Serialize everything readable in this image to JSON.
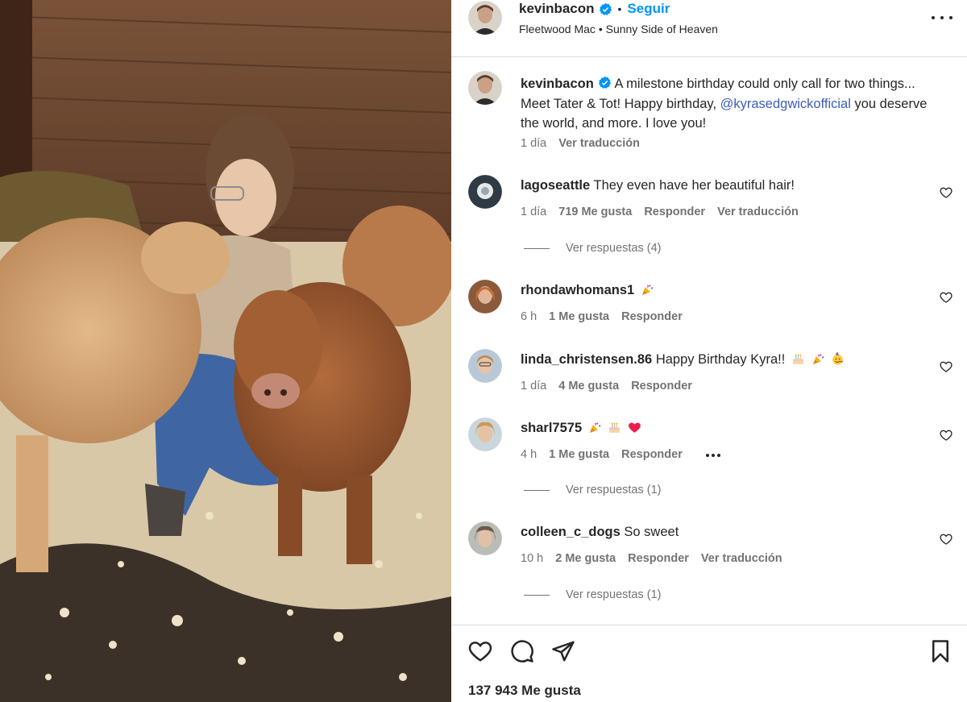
{
  "post": {
    "author": "kevinbacon",
    "follow_label": "Seguir",
    "audio": "Fleetwood Mac • Sunny Side of Heaven"
  },
  "caption": {
    "username": "kevinbacon",
    "text_before": "A milestone birthday could only call for two things... Meet Tater & Tot! Happy birthday, ",
    "mention": "@kyrasedgwickofficial",
    "text_after": " you deserve the world, and more. I love you!",
    "time": "1 día",
    "translate": "Ver traducción"
  },
  "comments": [
    {
      "username": "lagoseattle",
      "text": "They even have her beautiful hair!",
      "time": "1 día",
      "likes": "719 Me gusta",
      "reply": "Responder",
      "translate": "Ver traducción",
      "replies": "Ver respuestas (4)"
    },
    {
      "username": "rhondawhomans1",
      "text": "",
      "emojis": [
        "party-popper-emoji"
      ],
      "time": "6 h",
      "likes": "1 Me gusta",
      "reply": "Responder"
    },
    {
      "username": "linda_christensen.86",
      "text": "Happy Birthday Kyra!!",
      "emojis": [
        "birthday-cake-emoji",
        "party-popper-emoji",
        "partying-face-emoji"
      ],
      "time": "1 día",
      "likes": "4 Me gusta",
      "reply": "Responder"
    },
    {
      "username": "sharl7575",
      "text": "",
      "emojis": [
        "party-popper-emoji",
        "birthday-cake-emoji",
        "red-heart-emoji"
      ],
      "time": "4 h",
      "likes": "1 Me gusta",
      "reply": "Responder",
      "replies": "Ver respuestas (1)"
    },
    {
      "username": "colleen_c_dogs",
      "text": "So sweet",
      "time": "10 h",
      "likes": "2 Me gusta",
      "reply": "Responder",
      "translate": "Ver traducción",
      "replies": "Ver respuestas (1)"
    }
  ],
  "footer": {
    "likes": "137 943 Me gusta"
  },
  "colors": {
    "link_blue": "#0095f6",
    "mention_blue": "#3a5db8",
    "secondary_text": "#737373",
    "divider": "#dbdbdb"
  }
}
